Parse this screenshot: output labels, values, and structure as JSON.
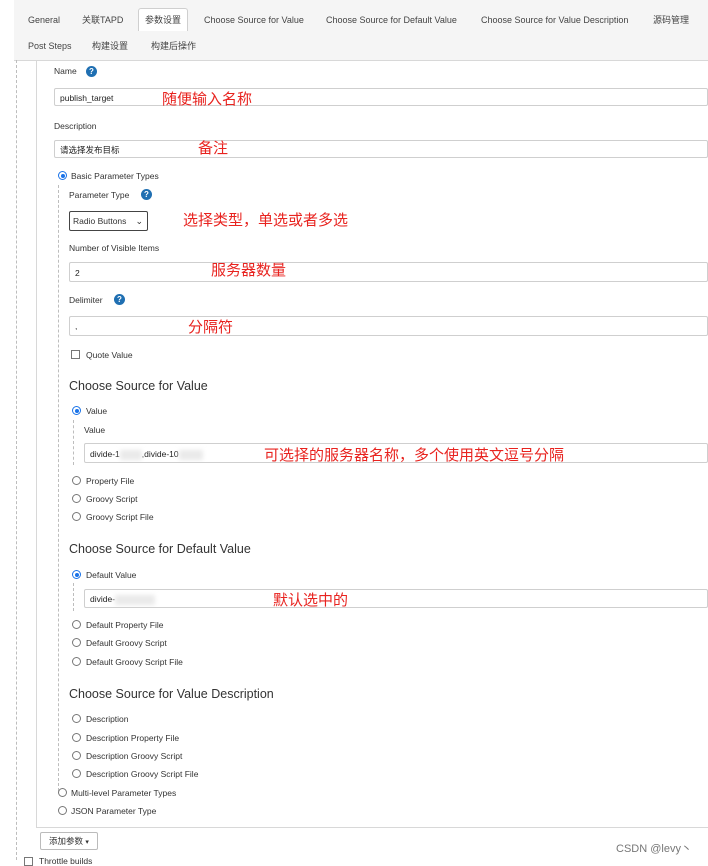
{
  "tabs": [
    {
      "label": "General",
      "active": false
    },
    {
      "label": "关联TAPD",
      "active": false
    },
    {
      "label": "参数设置",
      "active": true
    },
    {
      "label": "Choose Source for Value",
      "active": false
    },
    {
      "label": "Choose Source for Default Value",
      "active": false
    },
    {
      "label": "Choose Source for Value Description",
      "active": false
    },
    {
      "label": "源码管理",
      "active": false
    }
  ],
  "tabs_row2": [
    {
      "label": "Post Steps"
    },
    {
      "label": "构建设置"
    },
    {
      "label": "构建后操作"
    }
  ],
  "form": {
    "name_label": "Name",
    "name_value": "publish_target",
    "description_label": "Description",
    "description_value": "请选择发布目标",
    "basic_param_types": "Basic Parameter Types",
    "parameter_type_label": "Parameter Type",
    "parameter_type_value": "Radio Buttons",
    "visible_items_label": "Number of Visible Items",
    "visible_items_value": "2",
    "delimiter_label": "Delimiter",
    "delimiter_value": ",",
    "quote_value_label": "Quote Value"
  },
  "source_value": {
    "title": "Choose Source for Value",
    "value_radio": "Value",
    "value_label": "Value",
    "value_text_a": "divide-1",
    "value_text_b": ",divide-10",
    "options": [
      "Property File",
      "Groovy Script",
      "Groovy Script File"
    ]
  },
  "source_default": {
    "title": "Choose Source for Default Value",
    "default_radio": "Default Value",
    "default_text": "divide-",
    "options": [
      "Default Property File",
      "Default Groovy Script",
      "Default Groovy Script File"
    ]
  },
  "source_description": {
    "title": "Choose Source for Value Description",
    "options": [
      "Description",
      "Description Property File",
      "Description Groovy Script",
      "Description Groovy Script File"
    ]
  },
  "param_types": [
    "Multi-level Parameter Types",
    "JSON Parameter Type"
  ],
  "add_param_button": "添加参数",
  "throttle_label": "Throttle builds",
  "annotations": {
    "name": "随便输入名称",
    "description": "备注",
    "type": "选择类型，单选或者多选",
    "count": "服务器数量",
    "delimiter": "分隔符",
    "value": "可选择的服务器名称，多个使用英文逗号分隔",
    "default": "默认选中的"
  },
  "watermark": "CSDN @levy丶",
  "colors": {
    "annotation": "#e8231f",
    "help": "#1f6fb2",
    "radio_on": "#1a73e8"
  }
}
